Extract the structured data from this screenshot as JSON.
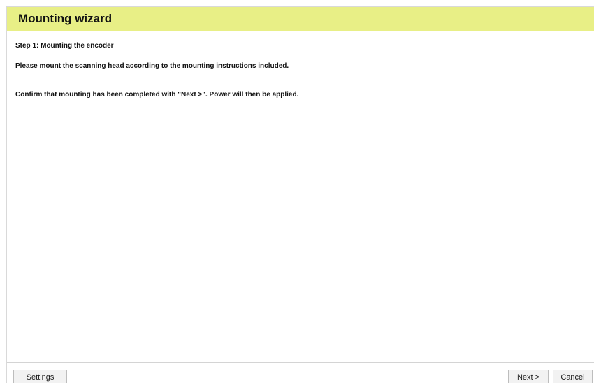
{
  "window": {
    "title": "Mounting wizard"
  },
  "step": {
    "title": "Step 1: Mounting the encoder",
    "instruction": "Please mount the scanning head according to the mounting instructions included.",
    "confirmation": "Confirm that mounting has been completed with \"Next >\". Power will then be applied."
  },
  "footer": {
    "settings_label": "Settings",
    "next_label": "Next >",
    "cancel_label": "Cancel"
  },
  "colors": {
    "title_bar_background": "#e8ef86",
    "button_background": "#f2f2f2"
  }
}
